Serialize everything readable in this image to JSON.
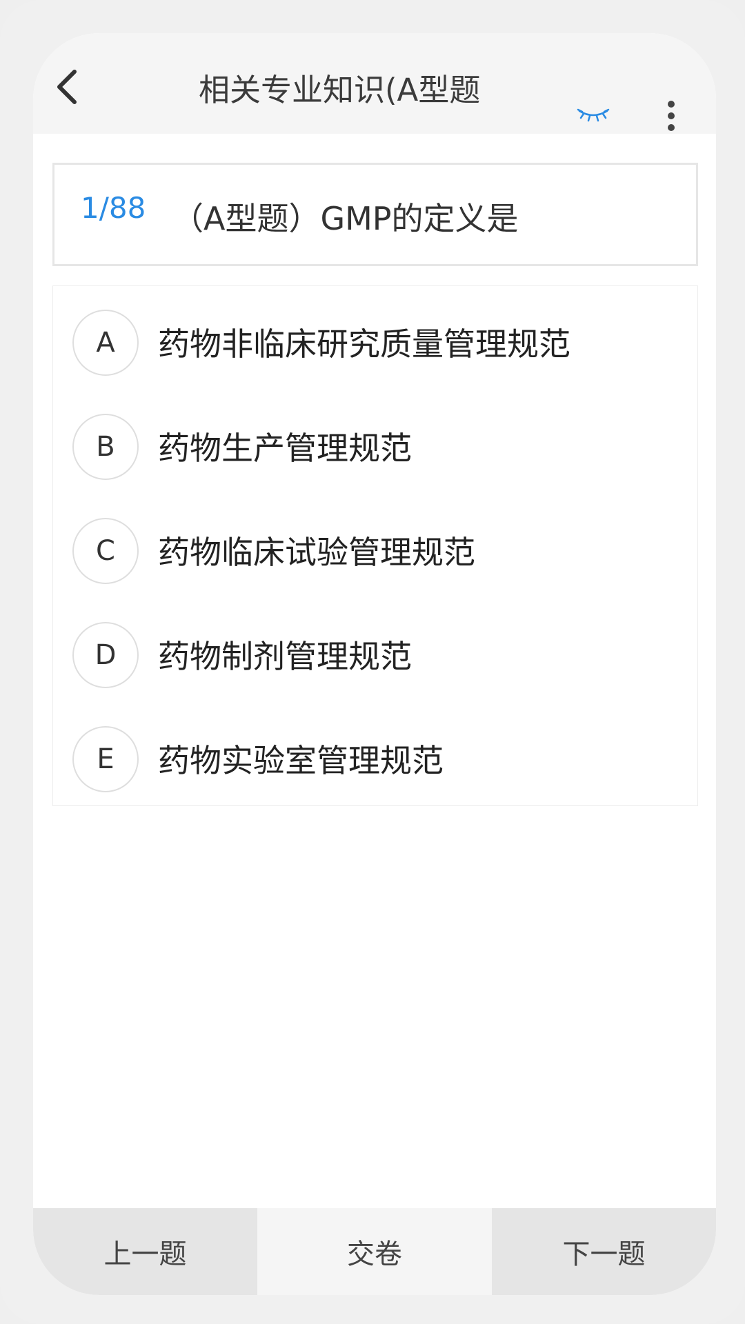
{
  "header": {
    "title": "相关专业知识(A型题",
    "icons": {
      "back": "chevron-left-icon",
      "eye": "eye-closed-icon",
      "more": "more-vertical-icon"
    },
    "accent_color": "#2a8be3"
  },
  "question": {
    "number": "1/88",
    "text": "（A型题）GMP的定义是"
  },
  "options": [
    {
      "letter": "A",
      "text": "药物非临床研究质量管理规范"
    },
    {
      "letter": "B",
      "text": "药物生产管理规范"
    },
    {
      "letter": "C",
      "text": "药物临床试验管理规范"
    },
    {
      "letter": "D",
      "text": "药物制剂管理规范"
    },
    {
      "letter": "E",
      "text": "药物实验室管理规范"
    }
  ],
  "footer": {
    "prev_label": "上一题",
    "submit_label": "交卷",
    "next_label": "下一题"
  }
}
